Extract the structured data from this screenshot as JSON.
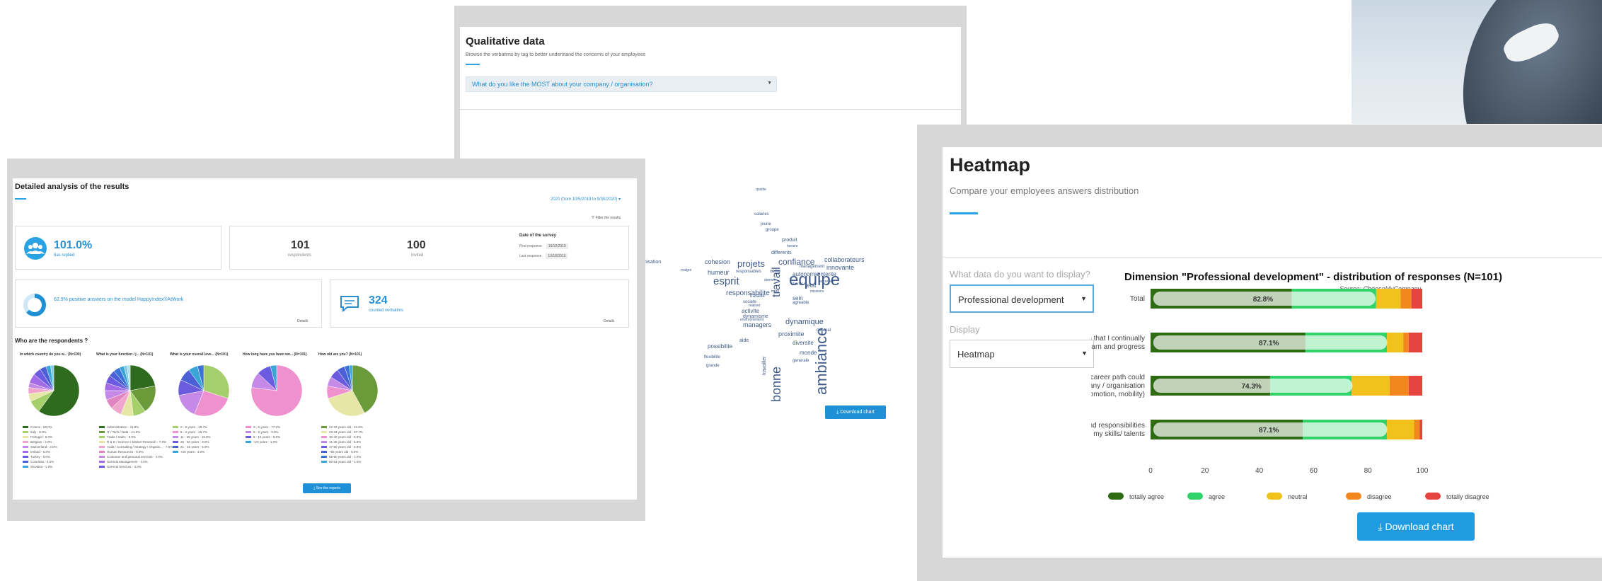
{
  "qualitative": {
    "title": "Qualitative data",
    "subtitle": "Browse the verbatims by tag to better understand the concerns of your employees",
    "question": "What do you like the MOST about your company / organisation?",
    "download_label": "Download chart",
    "words": [
      {
        "t": "equipe",
        "s": 24
      },
      {
        "t": "ambiance",
        "s": 22,
        "v": true
      },
      {
        "t": "bonne",
        "s": 18,
        "v": true
      },
      {
        "t": "travail",
        "s": 16,
        "v": true
      },
      {
        "t": "projets",
        "s": 13
      },
      {
        "t": "esprit",
        "s": 15
      },
      {
        "t": "confiance",
        "s": 12
      },
      {
        "t": "responsabilite",
        "s": 10
      },
      {
        "t": "cohesion",
        "s": 9
      },
      {
        "t": "humeur",
        "s": 9
      },
      {
        "t": "dynamique",
        "s": 11
      },
      {
        "t": "innovante",
        "s": 9
      },
      {
        "t": "collaborateurs",
        "s": 9
      },
      {
        "t": "managers",
        "s": 9
      },
      {
        "t": "activite",
        "s": 8
      },
      {
        "t": "proximite",
        "s": 9
      },
      {
        "t": "diversite",
        "s": 8
      },
      {
        "t": "monde",
        "s": 8
      },
      {
        "t": "possibilite",
        "s": 8
      },
      {
        "t": "autonomie",
        "s": 8
      },
      {
        "t": "entente",
        "s": 8
      },
      {
        "t": "produit",
        "s": 7
      },
      {
        "t": "differents",
        "s": 7
      },
      {
        "t": "sein",
        "s": 8
      },
      {
        "t": "etat",
        "s": 8
      },
      {
        "t": "aide",
        "s": 7
      },
      {
        "t": "flexibilite",
        "s": 6
      },
      {
        "t": "jeune",
        "s": 6
      },
      {
        "t": "salaries",
        "s": 6
      },
      {
        "t": "groupe",
        "s": 6
      },
      {
        "t": "generale",
        "s": 6
      },
      {
        "t": "general",
        "s": 6
      },
      {
        "t": "clients",
        "s": 6
      },
      {
        "t": "dynamisme",
        "s": 7
      },
      {
        "t": "travailler",
        "s": 7,
        "v": true
      },
      {
        "t": "societe",
        "s": 6
      },
      {
        "t": "cadre",
        "s": 6
      },
      {
        "t": "agreable",
        "s": 6
      },
      {
        "t": "grande",
        "s": 6
      },
      {
        "t": "missions",
        "s": 5
      },
      {
        "t": "accordee",
        "s": 5
      },
      {
        "t": "qualite",
        "s": 5
      },
      {
        "t": "horaire",
        "s": 5
      },
      {
        "t": "management",
        "s": 6
      },
      {
        "t": "responsables",
        "s": 6
      },
      {
        "t": "travaille",
        "s": 6
      },
      {
        "t": "realiser",
        "s": 5
      },
      {
        "t": "environnement",
        "s": 5
      },
      {
        "t": "nisation",
        "s": 7
      },
      {
        "t": "malgre",
        "s": 5
      },
      {
        "t": "donnee",
        "s": 5
      },
      {
        "t": "toute",
        "s": 5
      }
    ]
  },
  "detailed": {
    "title": "Detailed analysis of the results",
    "date_range": "2020 (from 10/5/2019 to 9/30/2020) ▾",
    "filter": "Filter the results",
    "replied_pct": "101.0%",
    "replied_label": "has replied",
    "respondents": "101",
    "respondents_label": "respondents",
    "invited": "100",
    "invited_label": "invited",
    "survey_date_title": "Date of the survey",
    "first_response_label": "First response",
    "first_response": "10/19/2019",
    "last_response_label": "Last response",
    "last_response": "10/18/2019",
    "positive_text": "62.9% positive answers on the model HappyIndex®AtWork",
    "positive_pct": 0.629,
    "verbatims_count": "324",
    "verbatims_label": "counted verbatims",
    "details_label": "Details",
    "section_title": "Who are the respondents ?",
    "reports_label": "See the reports",
    "pies": [
      {
        "title": "In which country do you w... (N=100)",
        "slices": [
          60,
          8,
          5,
          4,
          3,
          6,
          5,
          4,
          3,
          2
        ],
        "colors": [
          "#2f6b1e",
          "#a5cf6a",
          "#e6e6a6",
          "#f0a6cc",
          "#c58ae8",
          "#a36be8",
          "#6a5bdf",
          "#4b5fd6",
          "#3aa6d8",
          "#7ec8e8"
        ],
        "legend": [
          "France - 60.0%",
          "Italy - 8.0%",
          "Portugal - 5.0%",
          "Belgium - 4.0%",
          "Switzerland - 3.0%",
          "Ireland - 6.0%",
          "Turkey - 5.0%",
          "Colombia - 4.0%",
          "Slovakia - 1.0%"
        ]
      },
      {
        "title": "What is your function / j... (N=101)",
        "slices": [
          22,
          18,
          8,
          8,
          7,
          6,
          6,
          5,
          5,
          4,
          4,
          3,
          2,
          2
        ],
        "colors": [
          "#2f6b1e",
          "#6a9a3a",
          "#a5cf6a",
          "#e6e6a6",
          "#f0a6cc",
          "#e085c0",
          "#c58ae8",
          "#a36be8",
          "#6a5bdf",
          "#4b5fd6",
          "#3a72d8",
          "#3aa6d8",
          "#7ec8e8",
          "#b0ddef"
        ],
        "legend": [
          "Administration - 21.8%",
          "IT / Tech / Data - 21.8%",
          "Trade / Sales - 8.9%",
          "R & D / Science / Market Research - 7.9%",
          "Audit / Consulting / Strategy / Organis... - 7.9%",
          "Human Resources - 5.9%",
          "Customer and personal services - 4.0%",
          "General Management - 4.0%",
          "General Services - 3.0%"
        ]
      },
      {
        "title": "What is your overall leve... (N=101)",
        "slices": [
          30,
          26,
          16,
          10,
          8,
          6,
          4
        ],
        "colors": [
          "#a5cf6a",
          "#f091cf",
          "#c58ae8",
          "#6a5bdf",
          "#4b5fd6",
          "#3aa6d8",
          "#3a72d8"
        ],
        "legend": [
          "0 - 5 years - 29.7%",
          "5 - 2 years - 25.7%",
          "11 - 25 years - 15.8%",
          "25 - 50 years - 9.9%",
          "21 - 25 years - 5.9%",
          "+20 years - 4.0%"
        ]
      },
      {
        "title": "How long have you been wo... (N=101)",
        "slices": [
          77,
          10,
          9,
          4
        ],
        "colors": [
          "#f091cf",
          "#c58ae8",
          "#6a5bdf",
          "#3aa6d8"
        ],
        "legend": [
          "0 - 5 years - 77.2%",
          "5 - 8 years - 9.9%",
          "8 - 15 years - 8.9%",
          "+20 years - 1.0%"
        ]
      },
      {
        "title": "How old are you? (N=101)",
        "slices": [
          42,
          28,
          8,
          6,
          6,
          5,
          3,
          2
        ],
        "colors": [
          "#6a9a3a",
          "#e6e6a6",
          "#f091cf",
          "#c58ae8",
          "#6a5bdf",
          "#4b5fd6",
          "#3a72d8",
          "#3aa6d8"
        ],
        "legend": [
          "22-33 years old - 41.6%",
          "28-34 years old - 27.7%",
          "35-40 years old - 8.9%",
          "41-45 years old - 5.9%",
          "47-50 years old - 5.9%",
          "+55 years old - 5.0%",
          "55-60 years old - 1.0%",
          "60-64 years old - 1.0%"
        ]
      }
    ]
  },
  "heatmap": {
    "title": "Heatmap",
    "subtitle": "Compare your employees answers distribution",
    "data_label": "What data do you want to display?",
    "data_value": "Professional development",
    "display_label": "Display",
    "display_value": "Heatmap",
    "download_label": "Download chart",
    "colors": {
      "totally_agree": "#2e6b12",
      "agree": "#2fd36a",
      "neutral": "#f1c21b",
      "disagree": "#f2871d",
      "totally_disagree": "#e8443f"
    }
  },
  "chart_data": {
    "type": "bar",
    "title": "Dimension \"Professional development\" - distribution of responses (N=101)",
    "source": "Source: ChooseMyCompany",
    "categories": [
      "Total",
      "I have the impression that I continually learn and progress",
      "I can see how my career path could develop in my company / organisation (projects, promotion, mobility)",
      "I feel that my job and responsibilities correspond well to my skills/ talents"
    ],
    "category_lines": [
      [
        "Total"
      ],
      [
        "I have the impression that I continually",
        "learn and progress"
      ],
      [
        "I can see how my career path could",
        "develop in my company / organisation",
        "(projects, promotion, mobility)"
      ],
      [
        "I feel that my job and responsibilities",
        "correspond well to my skills/ talents"
      ]
    ],
    "overlay_labels": [
      "82.8%",
      "87.1%",
      "74.3%",
      "87.1%"
    ],
    "overlay_values": [
      82.8,
      87.1,
      74.3,
      87.1
    ],
    "series": [
      {
        "name": "totally agree",
        "values": [
          52,
          57,
          44,
          56
        ]
      },
      {
        "name": "agree",
        "values": [
          31,
          30,
          30,
          31
        ]
      },
      {
        "name": "neutral",
        "values": [
          9,
          6,
          14,
          10
        ]
      },
      {
        "name": "disagree",
        "values": [
          4,
          2,
          7,
          2
        ]
      },
      {
        "name": "totally disagree",
        "values": [
          4,
          5,
          5,
          1
        ]
      }
    ],
    "xlim": [
      0,
      100
    ],
    "xticks": [
      "0",
      "20",
      "40",
      "60",
      "80",
      "100"
    ],
    "legend_position": "bottom",
    "stacked": true
  }
}
